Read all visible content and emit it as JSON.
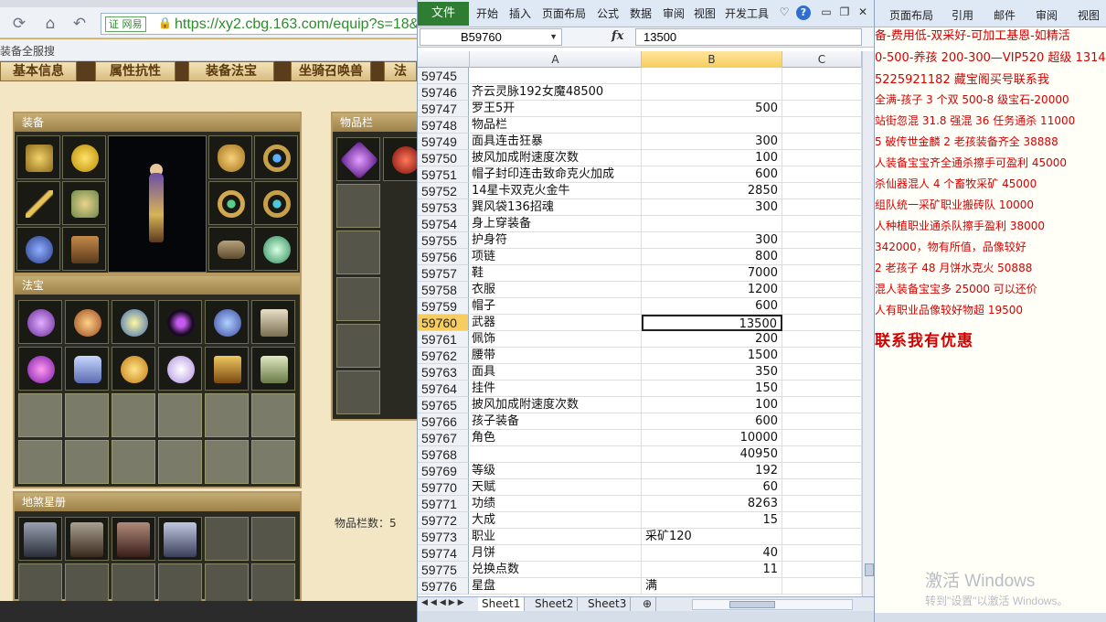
{
  "browser": {
    "cert_label": "证 网易",
    "url": "https://xy2.cbg.163.com/equip?s=18&e",
    "bookmark": "装备全服搜",
    "game_tabs": [
      "基本信息",
      "属性抗性",
      "装备法宝",
      "坐骑召唤兽",
      "法"
    ],
    "panels": {
      "equip_title": "装备",
      "fabao_title": "法宝",
      "bag_title": "物品栏",
      "star_title": "地煞星册"
    },
    "bag_count": "物品栏数：5"
  },
  "excel": {
    "file_tab": "文件",
    "ribbon_tabs": [
      "开始",
      "插入",
      "页面布局",
      "公式",
      "数据",
      "审阅",
      "视图",
      "开发工具"
    ],
    "name_box": "B59760",
    "formula_value": "13500",
    "columns": [
      "A",
      "B",
      "C"
    ],
    "rows": [
      {
        "n": "59745",
        "a": "",
        "b": ""
      },
      {
        "n": "59746",
        "a": "齐云灵脉192女魔48500",
        "b": ""
      },
      {
        "n": "59747",
        "a": "罗王5开",
        "b": "500"
      },
      {
        "n": "59748",
        "a": "物品栏",
        "b": ""
      },
      {
        "n": "59749",
        "a": "面具连击狂暴",
        "b": "300"
      },
      {
        "n": "59750",
        "a": "披风加成附速度次数",
        "b": "100"
      },
      {
        "n": "59751",
        "a": "帽子封印连击致命克火加成",
        "b": "600"
      },
      {
        "n": "59752",
        "a": "14星卡双克火金牛",
        "b": "2850"
      },
      {
        "n": "59753",
        "a": "巽风袋136招魂",
        "b": "300"
      },
      {
        "n": "59754",
        "a": "身上穿装备",
        "b": ""
      },
      {
        "n": "59755",
        "a": "护身符",
        "b": "300"
      },
      {
        "n": "59756",
        "a": "项链",
        "b": "800"
      },
      {
        "n": "59757",
        "a": "鞋",
        "b": "7000"
      },
      {
        "n": "59758",
        "a": "衣服",
        "b": "1200"
      },
      {
        "n": "59759",
        "a": "帽子",
        "b": "600"
      },
      {
        "n": "59760",
        "a": "武器",
        "b": "13500"
      },
      {
        "n": "59761",
        "a": "佩饰",
        "b": "200"
      },
      {
        "n": "59762",
        "a": "腰带",
        "b": "1500"
      },
      {
        "n": "59763",
        "a": "面具",
        "b": "350"
      },
      {
        "n": "59764",
        "a": "挂件",
        "b": "150"
      },
      {
        "n": "59765",
        "a": "披风加成附速度次数",
        "b": "100"
      },
      {
        "n": "59766",
        "a": "孩子装备",
        "b": "600"
      },
      {
        "n": "59767",
        "a": "角色",
        "b": "10000"
      },
      {
        "n": "59768",
        "a": "",
        "b": "40950"
      },
      {
        "n": "59769",
        "a": "等级",
        "b": "192"
      },
      {
        "n": "59770",
        "a": "天赋",
        "b": "60"
      },
      {
        "n": "59771",
        "a": "功绩",
        "b": "8263"
      },
      {
        "n": "59772",
        "a": "大成",
        "b": "15"
      },
      {
        "n": "59773",
        "a": "职业",
        "b": "采矿120"
      },
      {
        "n": "59774",
        "a": "月饼",
        "b": "40"
      },
      {
        "n": "59775",
        "a": "兑换点数",
        "b": "11"
      },
      {
        "n": "59776",
        "a": "星盘",
        "b": "满"
      }
    ],
    "sheets": [
      "Sheet1",
      "Sheet2",
      "Sheet3"
    ]
  },
  "word": {
    "ribbon_tabs": [
      "页面布局",
      "引用",
      "邮件",
      "审阅",
      "视图"
    ],
    "lines": [
      "备-费用低-双采好-可加工基恩-如精活",
      "0-500-养孩 200-300—VIP520 超级 1314",
      "5225921182   藏宝阁买号联系我",
      "全满-孩子 3 个双 500-8 级宝石-20000",
      "站街忽混 31.8 强混 36 任务通杀 11000",
      "5 破传世金麟 2 老孩装备齐全 38888",
      "人装备宝宝齐全通杀擦手可盈利 45000",
      "杀仙器混人 4 个畜牧采矿 45000",
      "组队统一采矿职业搬砖队 10000",
      "人种植职业通杀队擦手盈利 38000",
      "342000，物有所值，品像较好",
      "2 老孩子 48 月饼水克火 50888",
      "混人装备宝宝多 25000 可以还价",
      "人有职业品像较好物超 19500"
    ],
    "promo": "联系我有优惠",
    "watermark": "激活 Windows",
    "watermark_sub": "转到\"设置\"以激活 Windows。"
  },
  "colors": {
    "excel_file_tab": "#2f7d32",
    "selected_header": "#f6cd5e",
    "word_text": "#d40000",
    "game_panel_border": "#b59a62"
  }
}
